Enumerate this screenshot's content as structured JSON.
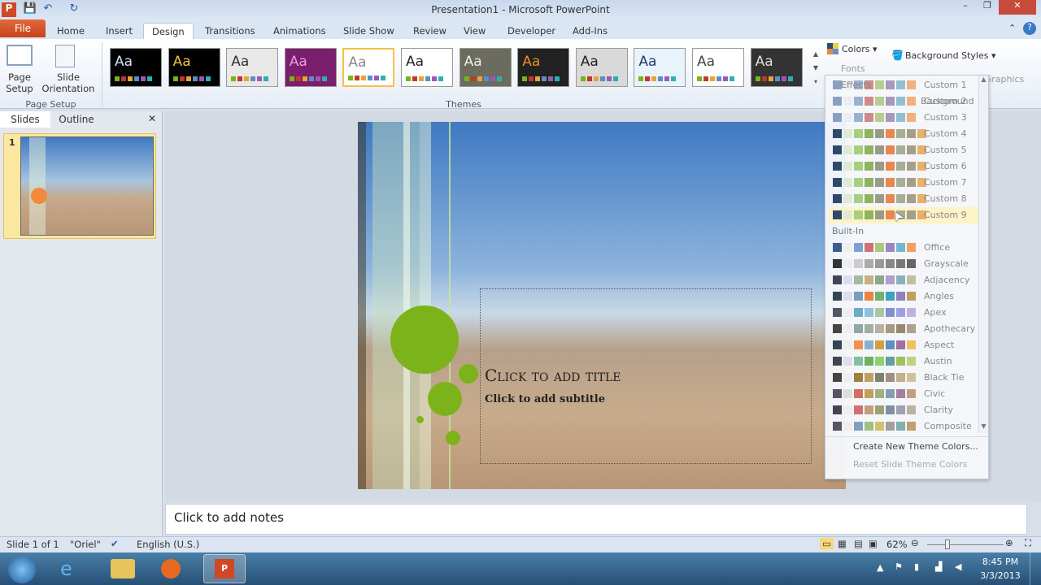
{
  "window": {
    "title": "Presentation1 - Microsoft PowerPoint"
  },
  "tabs": [
    "File",
    "Home",
    "Insert",
    "Design",
    "Transitions",
    "Animations",
    "Slide Show",
    "Review",
    "View",
    "Developer",
    "Add-Ins"
  ],
  "active_tab": "Design",
  "ribbon": {
    "page_setup": {
      "page_setup": "Page Setup",
      "slide_orientation": "Slide Orientation",
      "group": "Page Setup"
    },
    "themes_group": "Themes",
    "colors": "Colors",
    "fonts": "Fonts",
    "effects": "Effects",
    "background_styles": "Background Styles",
    "hide_background_graphics": "Hide Background Graphics",
    "background_group": "Background",
    "theme_thumbs": [
      {
        "label": "Aa",
        "bg": "#000",
        "fg": "#cfe3ff"
      },
      {
        "label": "Aa",
        "bg": "#000",
        "fg": "#f0c040"
      },
      {
        "label": "Aa",
        "bg": "#e8e8e8",
        "fg": "#333"
      },
      {
        "label": "Aa",
        "bg": "#7a1f6e",
        "fg": "#e6a0e0"
      },
      {
        "label": "Aa",
        "bg": "#fff",
        "fg": "#888"
      },
      {
        "label": "Aa",
        "bg": "#fff",
        "fg": "#222"
      },
      {
        "label": "Aa",
        "bg": "#6b6b5e",
        "fg": "#eee"
      },
      {
        "label": "Aa",
        "bg": "#222",
        "fg": "#f08a24"
      },
      {
        "label": "Aa",
        "bg": "#d9d9d9",
        "fg": "#222"
      },
      {
        "label": "Aa",
        "bg": "#e9f3fb",
        "fg": "#1d3c6b"
      },
      {
        "label": "Aa",
        "bg": "#fff",
        "fg": "#444"
      },
      {
        "label": "Aa",
        "bg": "#333",
        "fg": "#ddd"
      }
    ]
  },
  "left_panel": {
    "tabs": [
      "Slides",
      "Outline"
    ],
    "slide_number": "1"
  },
  "slide": {
    "title": "Click to add title",
    "subtitle": "Click to add subtitle"
  },
  "notes": "Click to add notes",
  "colors_dropdown": {
    "custom": [
      "Custom 1",
      "Custom 2",
      "Custom 3",
      "Custom 4",
      "Custom 5",
      "Custom 6",
      "Custom 7",
      "Custom 8",
      "Custom 9"
    ],
    "builtin_header": "Built-In",
    "builtin": [
      "Office",
      "Grayscale",
      "Adjacency",
      "Angles",
      "Apex",
      "Apothecary",
      "Aspect",
      "Austin",
      "Black Tie",
      "Civic",
      "Clarity",
      "Composite"
    ],
    "highlighted": "Custom 9",
    "create": "Create New Theme Colors...",
    "reset": "Reset Slide Theme Colors"
  },
  "status": {
    "slide": "Slide 1 of 1",
    "theme": "\"Oriel\"",
    "language": "English (U.S.)",
    "zoom": "62%"
  },
  "taskbar": {
    "time": "8:45 PM",
    "date": "3/3/2013"
  }
}
